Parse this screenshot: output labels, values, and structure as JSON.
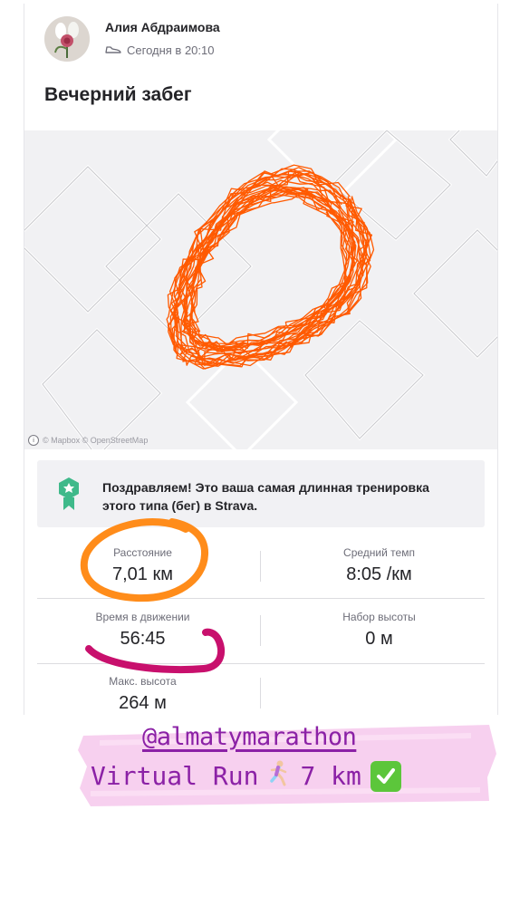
{
  "post": {
    "author": "Алия Абдраимова",
    "timestamp": "Сегодня в 20:10",
    "title": "Вечерний забег"
  },
  "map": {
    "attribution": "© Mapbox © OpenStreetMap"
  },
  "achievement": {
    "text": "Поздравляем! Это ваша самая длинная тренировка этого типа (бег) в Strava."
  },
  "stats": {
    "distance": {
      "label": "Расстояние",
      "value": "7,01 км"
    },
    "avg_pace": {
      "label": "Средний темп",
      "value": "8:05 /км"
    },
    "moving_time": {
      "label": "Время в движении",
      "value": "56:45"
    },
    "elevation_gain": {
      "label": "Набор высоты",
      "value": "0 м"
    },
    "max_elevation": {
      "label": "Макс. высота",
      "value": "264 м"
    }
  },
  "overlay": {
    "handle": "@almatymarathon",
    "caption": "Virtual Run",
    "distance_text": "7 km",
    "runner_icon": "runner-emoji",
    "check_icon": "check-mark-emoji"
  },
  "colors": {
    "route": "#ff5a00",
    "accent_orange": "#ff8c1a",
    "accent_magenta": "#c8106d",
    "caption_purple": "#8b21a6",
    "achievement_green": "#3fb98a",
    "brush_pink": "#f6c8ec"
  }
}
